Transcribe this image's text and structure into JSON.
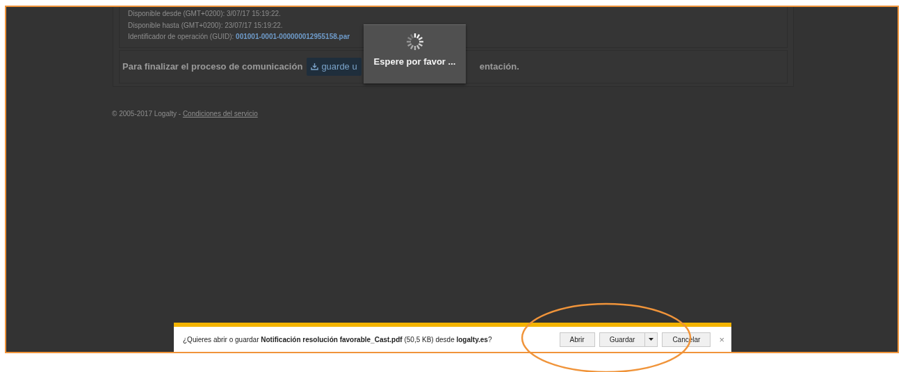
{
  "details": {
    "lines": [
      {
        "label": "Disponible desde (GMT+0200): 3/07/17 15:19:22."
      },
      {
        "label": "Disponible hasta (GMT+0200): 23/07/17 15:19:22."
      },
      {
        "label": "Identificador de operación (GUID): ",
        "link": "001001-0001-000000012955158.par"
      }
    ]
  },
  "finalize": {
    "text": "Para finalizar el proceso de comunicación",
    "button": "guarde u",
    "tail": "entación."
  },
  "footer": {
    "copyright": "© 2005-2017 Logalty - ",
    "link": "Condiciones del servicio"
  },
  "loading_dialog": {
    "message": "Espere por favor ..."
  },
  "download_bar": {
    "prompt": "¿Quieres abrir o guardar **Notificación resolución favorable_Cast.pdf** (50,5 KB) desde **logalty.es**?",
    "buttons": [
      {
        "label": "Abrir",
        "kind": "plain"
      },
      {
        "label": "Guardar",
        "kind": "split"
      },
      {
        "label": "Cancelar",
        "kind": "plain"
      }
    ],
    "close": "×"
  }
}
